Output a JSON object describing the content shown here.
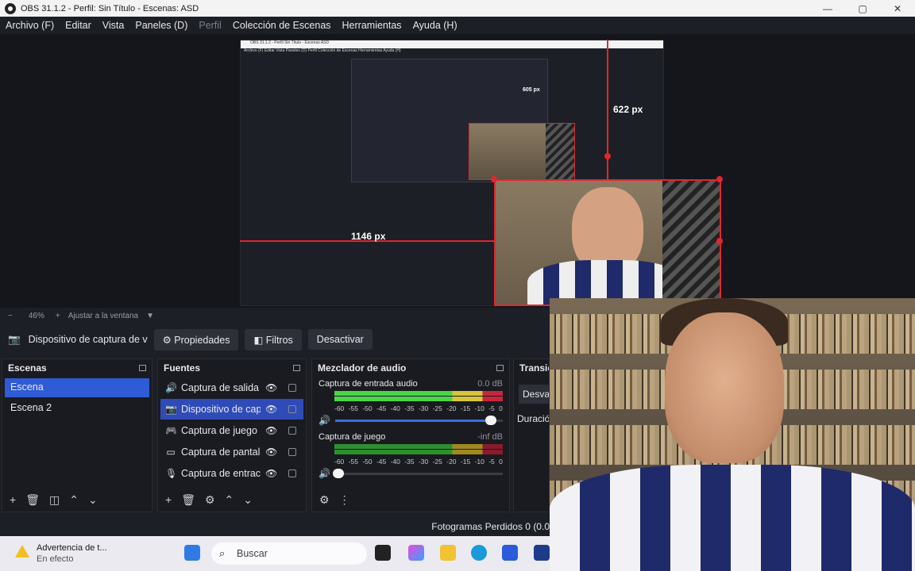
{
  "window": {
    "title": "OBS 31.1.2 - Perfil: Sin Título - Escenas: ASD",
    "controls": {
      "minimize": "—",
      "maximize": "▢",
      "close": "✕"
    }
  },
  "menu": {
    "items": [
      "Archivo (F)",
      "Editar",
      "Vista",
      "Paneles (D)",
      "Perfil",
      "Colección de Escenas",
      "Herramientas",
      "Ayuda (H)"
    ]
  },
  "preview": {
    "height_label": "622 px",
    "width_label": "1146 px",
    "inner_title": "OBS 31.1.2 - Perfil Sin Título - Escenas ASD",
    "inner_menu": "Archivo (F)   Editar   Vista   Paneles (D)   Perfil   Colección de Escenas   Herramientas   Ayuda (H)",
    "nested_label": "605 px"
  },
  "zoom": {
    "minus": "−",
    "level": "46%",
    "plus": "+",
    "fit_label": "Ajustar a la ventana",
    "arrow": "▼"
  },
  "source_bar": {
    "source_name": "Dispositivo de captura de v",
    "properties": "Propiedades",
    "filters": "Filtros",
    "deactivate": "Desactivar"
  },
  "scenes": {
    "title": "Escenas",
    "items": [
      "Escena",
      "Escena 2"
    ],
    "selected": 0
  },
  "sources": {
    "title": "Fuentes",
    "items": [
      {
        "label": "Captura de salida",
        "icon": "🔊"
      },
      {
        "label": "Dispositivo de cap",
        "icon": "📷"
      },
      {
        "label": "Captura de juego",
        "icon": "🎮"
      },
      {
        "label": "Captura de pantal",
        "icon": "▭"
      },
      {
        "label": "Captura de entrac",
        "icon": "🎙"
      }
    ],
    "selected": 1
  },
  "mixer": {
    "title": "Mezclador de audio",
    "channels": [
      {
        "name": "Captura de entrada audio",
        "db": "0.0 dB",
        "volume": 0.96
      },
      {
        "name": "Captura de juego",
        "db": "-inf dB",
        "volume": 0.05
      }
    ],
    "ticks": [
      "-60",
      "-55",
      "-50",
      "-45",
      "-40",
      "-35",
      "-30",
      "-25",
      "-20",
      "-15",
      "-10",
      "-5",
      "0"
    ]
  },
  "transitions": {
    "title": "Transici",
    "mode": "Desva",
    "duration": "Duració"
  },
  "status": {
    "dropped_frames": "Fotogramas Perdidos 0 (0.0"
  },
  "taskbar": {
    "notification_title": "Advertencia de t...",
    "notification_sub": "En efecto",
    "search_placeholder": "Buscar"
  },
  "colors": {
    "accent": "#2f5bd6",
    "resize_handle": "#e2262e",
    "meter_green": "#49d54a",
    "meter_yellow": "#d8c53a",
    "meter_red": "#c8263c"
  }
}
